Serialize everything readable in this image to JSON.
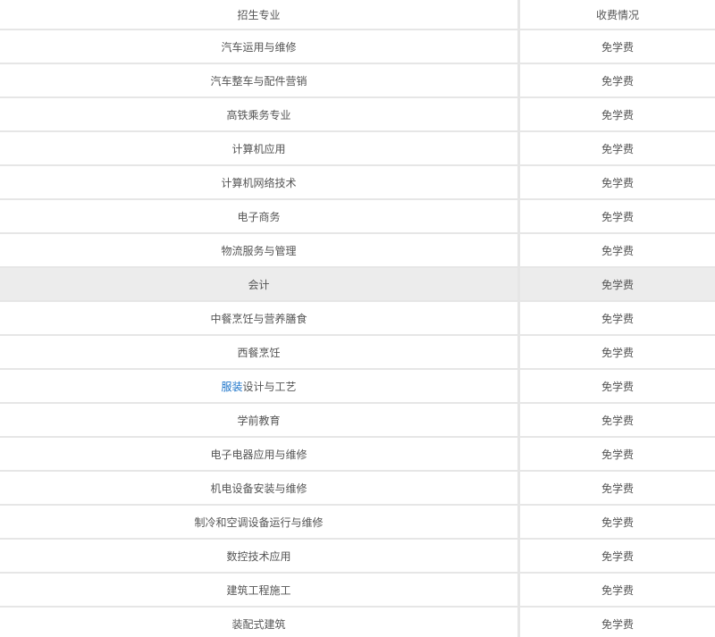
{
  "table": {
    "header": {
      "major": "招生专业",
      "fee": "收费情况"
    },
    "rows": [
      {
        "major": "汽车运用与维修",
        "fee": "免学费"
      },
      {
        "major": "汽车整车与配件营销",
        "fee": "免学费"
      },
      {
        "major": "高铁乘务专业",
        "fee": "免学费"
      },
      {
        "major": "计算机应用",
        "fee": "免学费"
      },
      {
        "major": "计算机网络技术",
        "fee": "免学费"
      },
      {
        "major": "电子商务",
        "fee": "免学费"
      },
      {
        "major": "物流服务与管理",
        "fee": "免学费"
      },
      {
        "major": "会计",
        "fee": "免学费"
      },
      {
        "major": "中餐烹饪与营养膳食",
        "fee": "免学费"
      },
      {
        "major": "西餐烹饪",
        "fee": "免学费"
      },
      {
        "major_link": "服装",
        "major_rest": "设计与工艺",
        "fee": "免学费"
      },
      {
        "major": "学前教育",
        "fee": "免学费"
      },
      {
        "major": "电子电器应用与维修",
        "fee": "免学费"
      },
      {
        "major": "机电设备安装与维修",
        "fee": "免学费"
      },
      {
        "major": "制冷和空调设备运行与维修",
        "fee": "免学费"
      },
      {
        "major": "数控技术应用",
        "fee": "免学费"
      },
      {
        "major": "建筑工程施工",
        "fee": "免学费"
      },
      {
        "major": "装配式建筑",
        "fee": "免学费"
      }
    ]
  },
  "colors": {
    "link": "#1a73c9",
    "row_highlight": "#ececec",
    "border": "#e6e6e6",
    "text": "#555555"
  }
}
